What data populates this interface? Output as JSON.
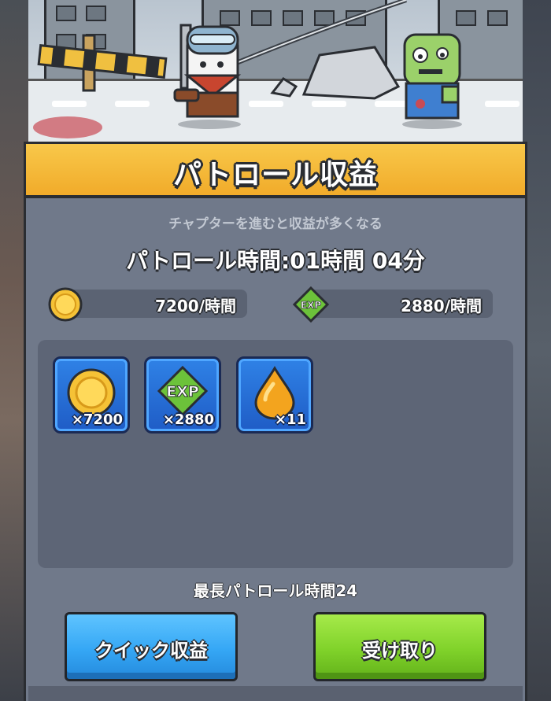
{
  "header": {
    "title": "パトロール収益"
  },
  "panel": {
    "subtitle": "チャプターを進むと収益が多くなる",
    "patrol_time": "パトロール時間:01時間 04分",
    "max_patrol_time": "最長パトロール時間24"
  },
  "rates": {
    "coin": {
      "icon": "gold-coin-icon",
      "value": "7200/時間"
    },
    "exp": {
      "icon": "exp-gem-icon",
      "label": "EXP",
      "value": "2880/時間"
    }
  },
  "rewards": [
    {
      "icon": "gold-coin-icon",
      "count": "×7200"
    },
    {
      "icon": "exp-gem-icon",
      "label": "EXP",
      "count": "×2880"
    },
    {
      "icon": "orange-drop-icon",
      "count": "×11"
    }
  ],
  "buttons": {
    "quick": "クイック収益",
    "claim": "受け取り"
  },
  "colors": {
    "header": "#f1ab2a",
    "panel": "#70798a",
    "quick_button": "#35a7f5",
    "claim_button": "#80d22a",
    "reward_tile": "#2f82e6"
  }
}
